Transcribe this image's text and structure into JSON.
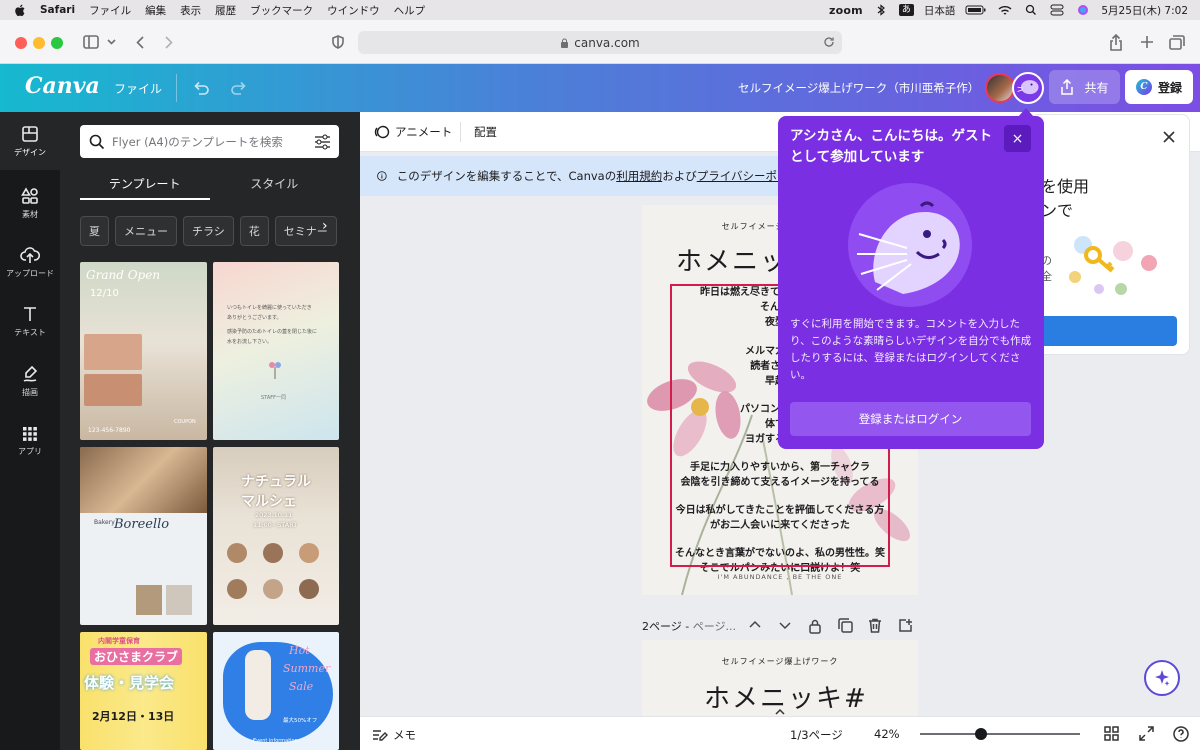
{
  "macos_menubar": {
    "app": "Safari",
    "menus": [
      "ファイル",
      "編集",
      "表示",
      "履歴",
      "ブックマーク",
      "ウインドウ",
      "ヘルプ"
    ],
    "zoom_label": "zoom",
    "input_method": "あ",
    "language": "日本語",
    "battery_label": "⚡",
    "datetime": "5月25日(木) 7:02"
  },
  "safari": {
    "url": "canva.com"
  },
  "canva_header": {
    "logo": "Canva",
    "file_menu": "ファイル",
    "document_title": "セルフイメージ爆上げワーク（市川亜希子作）",
    "share_label": "共有",
    "register_label": "登録",
    "register_icon_letter": "C"
  },
  "left_rail": {
    "items": [
      {
        "label": "デザイン",
        "icon": "layout-icon"
      },
      {
        "label": "素材",
        "icon": "elements-icon"
      },
      {
        "label": "アップロード",
        "icon": "upload-icon"
      },
      {
        "label": "テキスト",
        "icon": "text-icon"
      },
      {
        "label": "描画",
        "icon": "draw-icon"
      },
      {
        "label": "アプリ",
        "icon": "apps-grid-icon"
      }
    ]
  },
  "side_panel": {
    "search_placeholder": "Flyer (A4)のテンプレートを検索",
    "tabs": [
      "テンプレート",
      "スタイル"
    ],
    "chips": [
      "夏",
      "メニュー",
      "チラシ",
      "花",
      "セミナー",
      "親"
    ],
    "templates": [
      {
        "texts": [
          "Grand Open",
          "12/10",
          "123-456-7890",
          "COUPON"
        ]
      },
      {
        "texts": [
          "いつもトイレを綺麗に使っていただき",
          "ありがとうございます。",
          "感染予防のためトイレの蓋を閉じた後に",
          "水をお流し下さい。",
          "STAFF一同"
        ]
      },
      {
        "texts": [
          "Bakery",
          "Boreello"
        ]
      },
      {
        "texts": [
          "ナチュラル",
          "マルシェ",
          "2023.10.11",
          "11:00~START"
        ]
      },
      {
        "texts": [
          "内閣学童保育",
          "おひさまクラブ",
          "体験・見学会",
          "2月12日・13日"
        ]
      },
      {
        "texts": [
          "Hot",
          "Summer",
          "Sale",
          "最大50%オフ",
          "Event information"
        ]
      }
    ]
  },
  "context_bar": {
    "animate": "アニメート",
    "arrange": "配置"
  },
  "info_bar": {
    "prefix": "このデザインを編集することで、Canvaの",
    "terms": "利用規約",
    "middle": "および",
    "privacy": "プライバシーポリシ"
  },
  "page1": {
    "subtitle": "セルフイメージ爆上げワーク",
    "title": "ホメニッキ#",
    "lines": [
      "昨日は燃え尽きて日付が変わる前に",
      "そんなこ",
      "夜型の",
      "",
      "メルマガとアプ",
      "読者さんとつ",
      "早起き",
      "",
      "パソコンに向かい",
      "体でい",
      "ヨガするし、き",
      "",
      "手足に力入りやすいから、第一チャクラ",
      "会陰を引き締めて支えるイメージを持ってる",
      "",
      "今日は私がしてきたことを評価してくださる方",
      "がお二人会いに来てくださった",
      "",
      "そんなとき言葉がでないのよ、私の男性性。笑",
      "そこでルパンみたいに口説けよ！笑"
    ],
    "footer": "I'M ABUNDANCE , BE THE ONE"
  },
  "page2_bar": {
    "label": "2ページ - ",
    "placeholder": "ページ..."
  },
  "page2": {
    "subtitle": "セルフイメージ爆上げワーク",
    "title": "ホメニッキ#"
  },
  "right_panel": {
    "title_lines": [
      "を使用",
      "ンで"
    ],
    "body_lines": [
      "の",
      "全"
    ]
  },
  "popover": {
    "title": "アシカさん、こんにちは。ゲストとして参加しています",
    "body": "すぐに利用を開始できます。コメントを入力したり、このような素晴らしいデザインを自分でも作成したりするには、登録またはログインしてください。",
    "button": "登録またはログイン",
    "close": "×"
  },
  "bottom_bar": {
    "notes": "メモ",
    "pages": "1/3ページ",
    "zoom": "42%",
    "zoom_level_fraction": 0.38
  },
  "colors": {
    "header_gradient_start": "#16b9cf",
    "header_gradient_end": "#7c4ee4",
    "popover_bg": "#7b2fe3",
    "selection": "#d21c4b"
  }
}
